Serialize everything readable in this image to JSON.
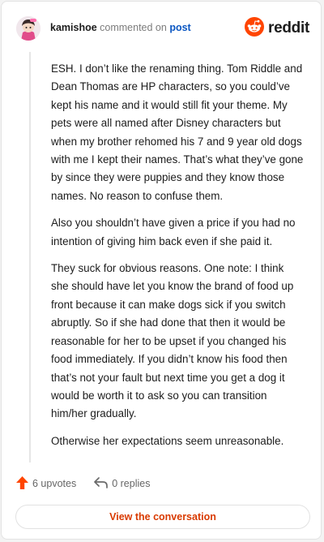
{
  "comment": {
    "username": "kamishoe",
    "action_text": "commented on",
    "post_link": "post",
    "brand": "reddit",
    "paragraphs": [
      "ESH. I don’t like the renaming thing. Tom Riddle and Dean Thomas are HP characters, so you could’ve kept his name and it would still fit your theme. My pets were all named after Disney characters but when my brother rehomed his 7 and 9 year old dogs with me I kept their names. That’s what they’ve gone by since they were puppies and they know those names. No reason to confuse them.",
      "Also you shouldn’t have given a price if you had no intention of giving him back even if she paid it.",
      "They suck for obvious reasons. One note: I think she should have let you know the brand of food up front because it can make dogs sick if you switch abruptly. So if she had done that then it would be reasonable for her to be upset if you changed his food immediately. If you didn’t know his food then that’s not your fault but next time you get a dog it would be worth it to ask so you can transition him/her gradually.",
      "Otherwise her expectations seem unreasonable."
    ],
    "upvotes_label": "6 upvotes",
    "replies_label": "0 replies",
    "view_button_label": "View the conversation"
  },
  "colors": {
    "accent": "#ff4500",
    "link": "#0b57c2",
    "button_text": "#d93a00"
  },
  "icons": [
    "avatar",
    "reddit-logo-icon",
    "upvote-arrow-icon",
    "reply-arrow-icon"
  ]
}
